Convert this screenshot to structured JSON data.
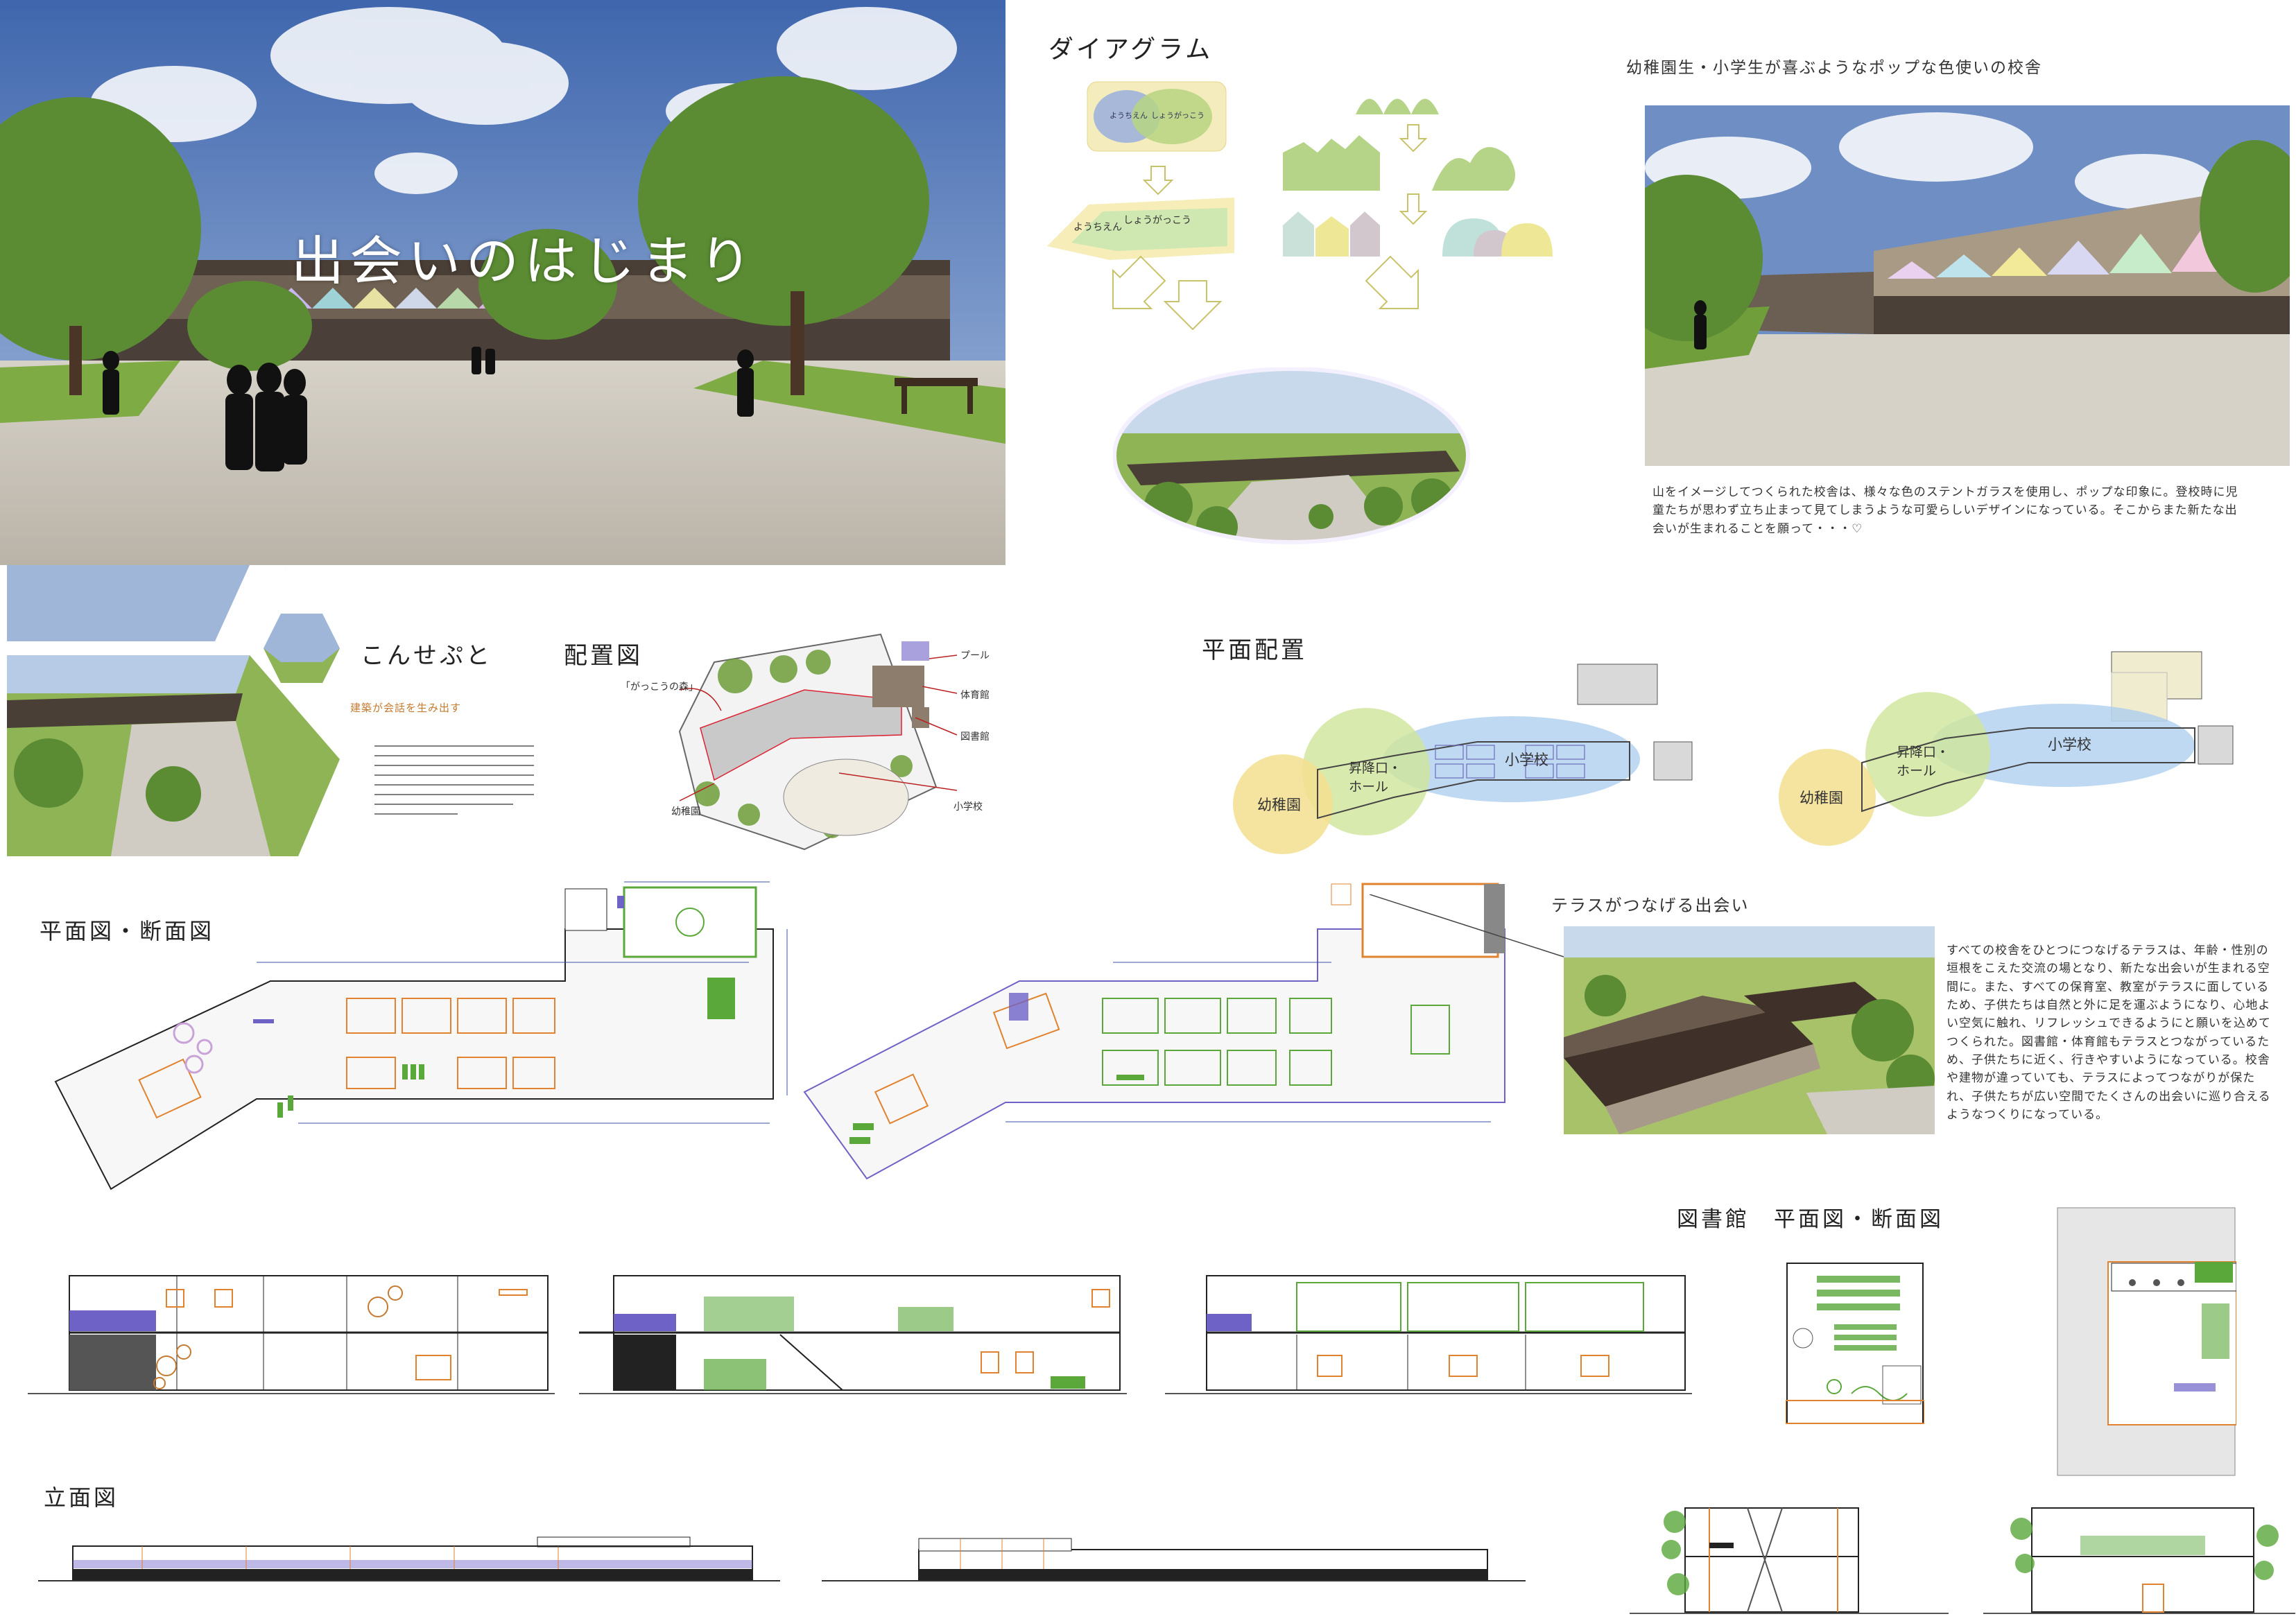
{
  "hero": {
    "title": "出会いのはじまり"
  },
  "diagram": {
    "heading": "ダイアグラム",
    "venn_left": "ようちえん",
    "venn_right": "しょうがっこう",
    "merge_left": "ようちえん",
    "merge_right": "しょうがっこう"
  },
  "render_panel": {
    "heading": "幼稚園生・小学生が喜ぶようなポップな色使いの校舎",
    "body": "山をイメージしてつくられた校舎は、様々な色のステントガラスを使用し、ポップな印象に。登校時に児童たちが思わず立ち止まって見てしまうような可愛らしいデザインになっている。そこからまた新たな出会いが生まれることを願って・・・♡"
  },
  "concept": {
    "heading": "こんせぷと",
    "subheading": "建築が会話を生み出す"
  },
  "site_plan": {
    "heading": "配置図",
    "labels": {
      "forest": "「がっこうの森」",
      "pool": "プール",
      "gym": "体育館",
      "library": "図書館",
      "elementary": "小学校",
      "kindergarten": "幼稚園"
    }
  },
  "floor_zoning": {
    "heading": "平面配置",
    "zones": {
      "kindergarten": "幼稚園",
      "entrance": "昇降口・ホール",
      "elementary": "小学校"
    }
  },
  "plans_sections": {
    "heading": "平面図・断面図"
  },
  "terrace": {
    "heading": "テラスがつなげる出会い",
    "body": "すべての校舎をひとつにつなげるテラスは、年齢・性別の垣根をこえた交流の場となり、新たな出会いが生まれる空間に。また、すべての保育室、教室がテラスに面しているため、子供たちは自然と外に足を運ぶようになり、心地よい空気に触れ、リフレッシュできるようにと願いを込めてつくられた。図書館・体育館もテラスとつながっているため、子供たちに近く、行きやすいようになっている。校舎や建物が違っていても、テラスによってつながりが保たれ、子供たちが広い空間でたくさんの出会いに巡り合えるようなつくりになっている。"
  },
  "library": {
    "heading": "図書館　平面図・断面図"
  },
  "elevation": {
    "heading": "立面図"
  },
  "colors": {
    "sky": "#6f8fc4",
    "grass": "#6f9e3a",
    "tree": "#4f7d2a",
    "pavement": "#c9c3b8",
    "zone_yellow": "#f3df8f",
    "zone_green": "#cfe59a",
    "zone_blue": "#a9ccef",
    "plan_green": "#5aa83a",
    "plan_orange": "#e0822e",
    "plan_purple": "#6e62c7"
  }
}
